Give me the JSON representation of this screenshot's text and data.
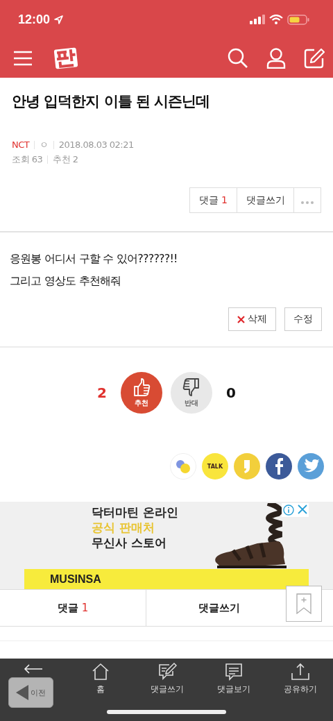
{
  "status_bar": {
    "time": "12:00"
  },
  "post": {
    "title": "안녕 입덕한지 이틀 된 시즌닌데",
    "category": "NCT",
    "author": "ㅇ",
    "date": "2018.08.03 02:21",
    "views": "조회 63",
    "recommends": "추천 2",
    "actions": [
      {
        "label": "댓글",
        "count": "1",
        "kind": "count"
      },
      {
        "label": "댓글쓰기",
        "kind": "plain"
      },
      {
        "kind": "more"
      }
    ],
    "body": [
      "응원봉 어디서 구할 수 있어??????!!",
      "그리고 영상도 추천해줘"
    ],
    "edit_buttons": [
      {
        "label": "삭제",
        "kind": "delete"
      },
      {
        "label": "수정",
        "kind": "plain"
      }
    ]
  },
  "vote": {
    "up_count": "2",
    "up_label": "추천",
    "up_selected": true,
    "down_label": "반대",
    "down_selected": false,
    "down_count": "0"
  },
  "share": [
    {
      "kind": "band"
    },
    {
      "kind": "talk",
      "label": "TALK"
    },
    {
      "kind": "story"
    },
    {
      "kind": "facebook"
    },
    {
      "kind": "twitter"
    }
  ],
  "ad": {
    "lines": [
      {
        "text": "닥터마틴 온라인",
        "highlight": false
      },
      {
        "text": "공식 판매처",
        "highlight": true
      },
      {
        "text": "무신사 스토어",
        "highlight": false
      }
    ],
    "brand": "MUSINSA"
  },
  "comment_bar": {
    "comments_label": "댓글",
    "comments_count": "1",
    "write_label": "댓글쓰기"
  },
  "back_button": {
    "label": "이전"
  },
  "toolbar": [
    {
      "kind": "home",
      "label": "홈"
    },
    {
      "kind": "write",
      "label": "댓글쓰기"
    },
    {
      "kind": "view",
      "label": "댓글보기"
    },
    {
      "kind": "share",
      "label": "공유하기"
    }
  ]
}
